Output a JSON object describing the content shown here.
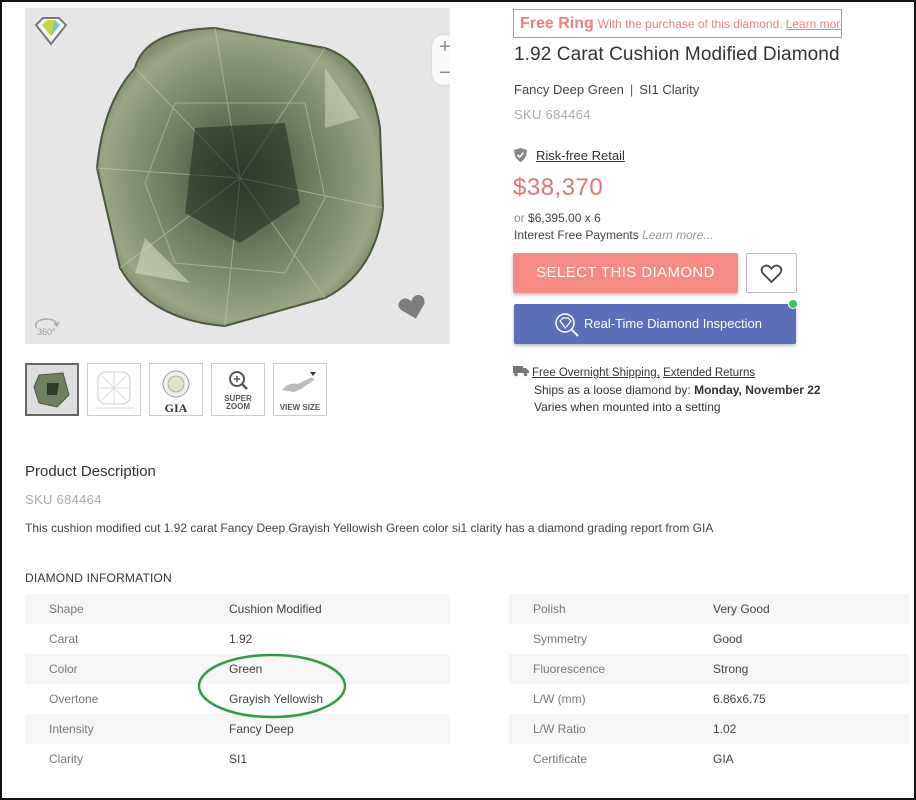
{
  "promo": {
    "headline": "Free Ring",
    "text": "With the purchase of this diamond.",
    "link": "Learn more."
  },
  "product": {
    "title": "1.92 Carat Cushion Modified Diamond",
    "color": "Fancy Deep Green",
    "separator": "|",
    "clarity": "SI1 Clarity",
    "sku": "SKU 684464",
    "risk_free": "Risk-free Retail",
    "price": "$38,370",
    "financing_prefix": "or",
    "financing_amount": "$6,395.00 x 6",
    "financing_label": "Interest Free Payments",
    "financing_link": "Learn more..."
  },
  "buttons": {
    "select": "SELECT THIS DIAMOND",
    "inspection": "Real-Time Diamond Inspection"
  },
  "shipping": {
    "free_shipping": "Free Overnight Shipping,",
    "returns": "Extended Returns",
    "ships_prefix": "Ships as a loose diamond by:",
    "ships_date": "Monday, November 22",
    "mounted": "Varies when mounted into a setting"
  },
  "viewer": {
    "zoom_in": "+",
    "zoom_out": "−",
    "rotate_label": "360°"
  },
  "thumbnails": [
    {
      "icon": "diamond-photo-icon",
      "caption": ""
    },
    {
      "icon": "diamond-diagram-icon",
      "caption": ""
    },
    {
      "icon": "gia-certificate-icon",
      "caption": "GIA"
    },
    {
      "icon": "magnifier-icon",
      "caption": "SUPER ZOOM"
    },
    {
      "icon": "hand-icon",
      "caption": "VIEW SIZE"
    }
  ],
  "description": {
    "title": "Product Description",
    "sku": "SKU 684464",
    "text": "This cushion modified cut 1.92 carat Fancy Deep Grayish Yellowish Green color si1 clarity has a diamond grading report from GIA"
  },
  "diamond_info": {
    "title": "DIAMOND INFORMATION",
    "left": [
      {
        "label": "Shape",
        "value": "Cushion Modified"
      },
      {
        "label": "Carat",
        "value": "1.92"
      },
      {
        "label": "Color",
        "value": "Green"
      },
      {
        "label": "Overtone",
        "value": "Grayish Yellowish"
      },
      {
        "label": "Intensity",
        "value": "Fancy Deep"
      },
      {
        "label": "Clarity",
        "value": "SI1"
      }
    ],
    "right": [
      {
        "label": "Polish",
        "value": "Very Good"
      },
      {
        "label": "Symmetry",
        "value": "Good"
      },
      {
        "label": "Fluorescence",
        "value": "Strong"
      },
      {
        "label": "L/W (mm)",
        "value": "6.86x6.75"
      },
      {
        "label": "L/W Ratio",
        "value": "1.02"
      },
      {
        "label": "Certificate",
        "value": "GIA"
      }
    ]
  },
  "colors": {
    "accent": "#f58b84",
    "price": "#e8726e",
    "inspection": "#5b6eb8",
    "online": "#39c463",
    "highlight_circle": "#2e9b45"
  }
}
